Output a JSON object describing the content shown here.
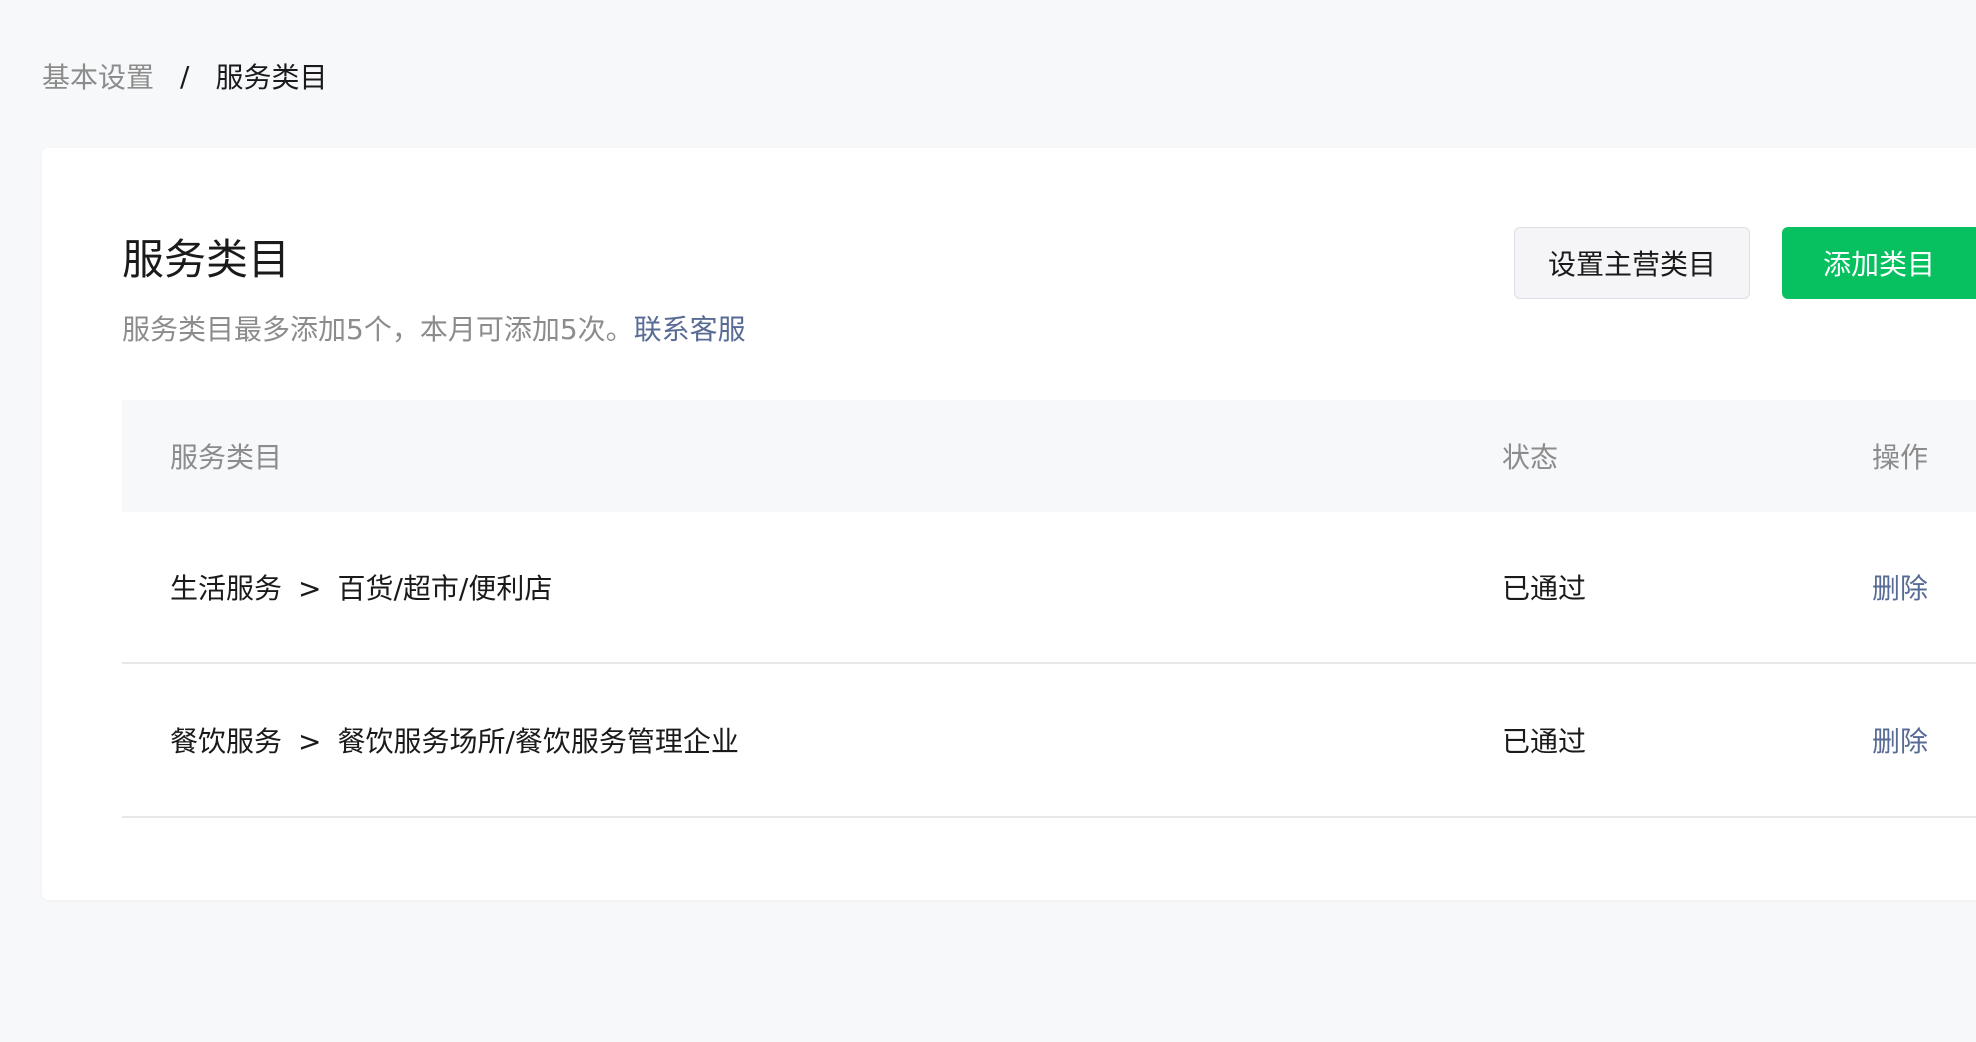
{
  "breadcrumb": {
    "parent": "基本设置",
    "separator": "/",
    "current": "服务类目"
  },
  "card": {
    "title": "服务类目",
    "description": "服务类目最多添加5个，本月可添加5次。",
    "contact_link": "联系客服",
    "buttons": {
      "set_main": "设置主营类目",
      "add": "添加类目"
    }
  },
  "table": {
    "headers": {
      "category": "服务类目",
      "status": "状态",
      "action": "操作"
    },
    "rows": [
      {
        "primary": "生活服务",
        "arrow": ">",
        "secondary": "百货/超市/便利店",
        "status": "已通过",
        "action": "删除"
      },
      {
        "primary": "餐饮服务",
        "arrow": ">",
        "secondary": "餐饮服务场所/餐饮服务管理企业",
        "status": "已通过",
        "action": "删除"
      }
    ]
  },
  "colors": {
    "primary": "#07c160",
    "link": "#576b95",
    "background": "#f7f8fa"
  }
}
